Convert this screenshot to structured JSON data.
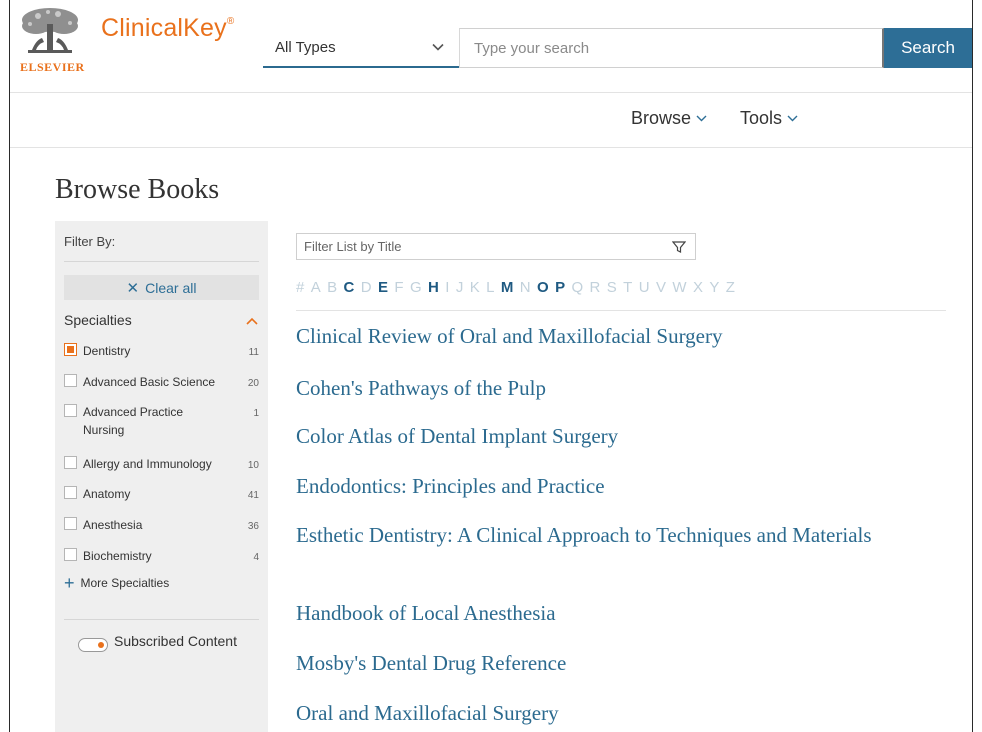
{
  "header": {
    "publisher": "ELSEVIER",
    "brand": "ClinicalKey",
    "brand_mark": "®",
    "type_select": "All Types",
    "search_placeholder": "Type your search",
    "search_button": "Search"
  },
  "nav": {
    "browse": "Browse",
    "tools": "Tools"
  },
  "page": {
    "title": "Browse Books"
  },
  "sidebar": {
    "filter_by": "Filter By:",
    "clear_all": "Clear all",
    "specialties_heading": "Specialties",
    "facets": [
      {
        "label": "Dentistry",
        "count": "11",
        "checked": true
      },
      {
        "label": "Advanced Basic Science",
        "count": "20",
        "checked": false
      },
      {
        "label": "Advanced Practice Nursing",
        "count": "1",
        "checked": false
      },
      {
        "label": "Allergy and Immunology",
        "count": "10",
        "checked": false
      },
      {
        "label": "Anatomy",
        "count": "41",
        "checked": false
      },
      {
        "label": "Anesthesia",
        "count": "36",
        "checked": false
      },
      {
        "label": "Biochemistry",
        "count": "4",
        "checked": false
      }
    ],
    "more_specialties": "More Specialties",
    "subscribed_content": "Subscribed Content"
  },
  "main": {
    "filter_placeholder": "Filter List by Title",
    "alphabet": [
      {
        "ch": "#",
        "on": false
      },
      {
        "ch": "A",
        "on": false
      },
      {
        "ch": "B",
        "on": false
      },
      {
        "ch": "C",
        "on": true
      },
      {
        "ch": "D",
        "on": false
      },
      {
        "ch": "E",
        "on": true
      },
      {
        "ch": "F",
        "on": false
      },
      {
        "ch": "G",
        "on": false
      },
      {
        "ch": "H",
        "on": true
      },
      {
        "ch": "I",
        "on": false
      },
      {
        "ch": "J",
        "on": false
      },
      {
        "ch": "K",
        "on": false
      },
      {
        "ch": "L",
        "on": false
      },
      {
        "ch": "M",
        "on": true
      },
      {
        "ch": "N",
        "on": false
      },
      {
        "ch": "O",
        "on": true
      },
      {
        "ch": "P",
        "on": true
      },
      {
        "ch": "Q",
        "on": false
      },
      {
        "ch": "R",
        "on": false
      },
      {
        "ch": "S",
        "on": false
      },
      {
        "ch": "T",
        "on": false
      },
      {
        "ch": "U",
        "on": false
      },
      {
        "ch": "V",
        "on": false
      },
      {
        "ch": "W",
        "on": false
      },
      {
        "ch": "X",
        "on": false
      },
      {
        "ch": "Y",
        "on": false
      },
      {
        "ch": "Z",
        "on": false
      }
    ],
    "books": [
      "Clinical Review of Oral and Maxillofacial Surgery",
      "Cohen's Pathways of the Pulp",
      "Color Atlas of Dental Implant Surgery",
      "Endodontics: Principles and Practice",
      "Esthetic Dentistry: A Clinical Approach to Techniques and Materials",
      "Handbook of Local Anesthesia",
      "Mosby's Dental Drug Reference",
      "Oral and Maxillofacial Surgery"
    ]
  },
  "colors": {
    "brand_orange": "#e9711c",
    "link_blue": "#2b6a8f",
    "search_button": "#2d6e96",
    "sidebar_bg": "#efefef"
  }
}
